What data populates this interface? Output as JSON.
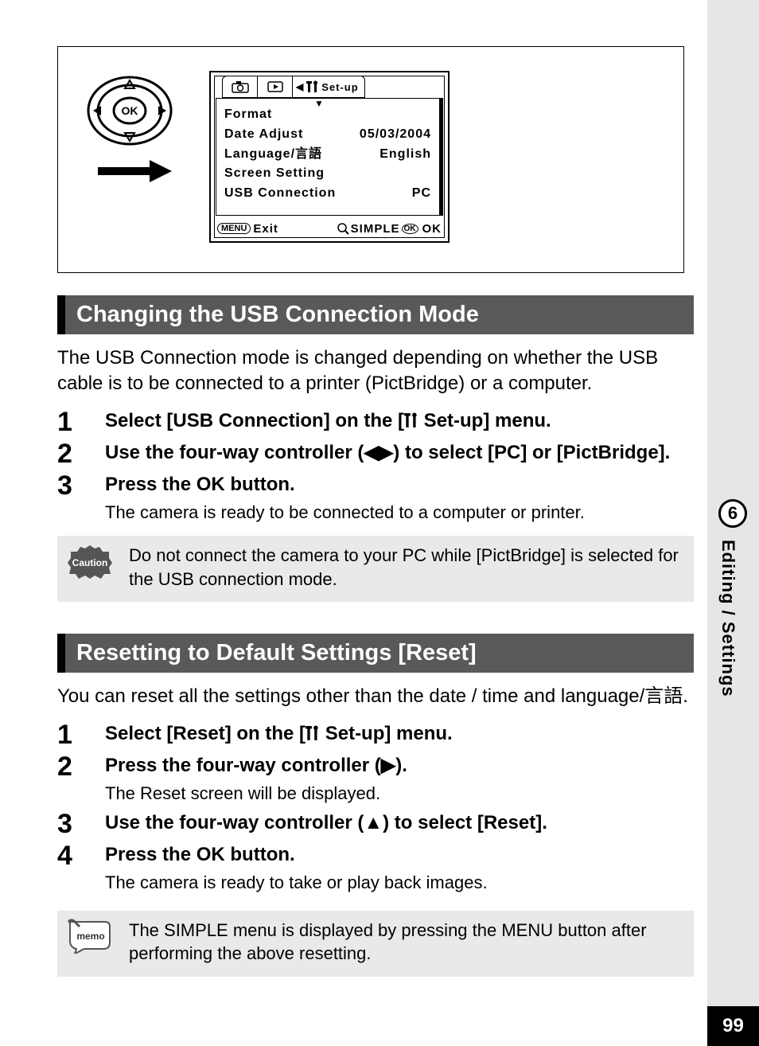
{
  "page_number": "99",
  "chapter_number": "6",
  "chapter_label": "Editing / Settings",
  "lcd": {
    "tab_label": "Set-up",
    "rows": [
      {
        "label": "Format",
        "value": ""
      },
      {
        "label": "Date Adjust",
        "value": "05/03/2004"
      },
      {
        "label": "Language/言語",
        "value": "English"
      },
      {
        "label": "Screen Setting",
        "value": ""
      },
      {
        "label": "USB Connection",
        "value": "PC"
      }
    ],
    "foot_menu": "MENU",
    "foot_exit": "Exit",
    "foot_simple": "SIMPLE",
    "foot_ok": "OK"
  },
  "section1": {
    "title": "Changing the USB Connection Mode",
    "intro": "The USB Connection mode is changed depending on whether the USB cable is to be connected to a printer (PictBridge) or a computer.",
    "steps": [
      {
        "n": "1",
        "title_pre": "Select [USB Connection] on the [",
        "title_post": " Set-up] menu."
      },
      {
        "n": "2",
        "title": "Use the four-way controller (◀▶) to select [PC] or [PictBridge]."
      },
      {
        "n": "3",
        "title": "Press the OK button.",
        "sub": "The camera is ready to be connected to a computer or printer."
      }
    ],
    "caution": "Do not connect the camera to your PC while [PictBridge] is selected for the USB connection mode."
  },
  "section2": {
    "title": "Resetting to Default Settings [Reset]",
    "intro": "You can reset all the settings other than the date / time and language/",
    "intro_suffix": "言語",
    "intro_end": ".",
    "steps": [
      {
        "n": "1",
        "title_pre": "Select [Reset] on the [",
        "title_post": " Set-up] menu."
      },
      {
        "n": "2",
        "title": "Press the four-way controller (▶).",
        "sub": "The Reset screen will be displayed."
      },
      {
        "n": "3",
        "title": "Use the four-way controller (▲) to select [Reset]."
      },
      {
        "n": "4",
        "title": "Press the OK button.",
        "sub": "The camera is ready to take or play back images."
      }
    ],
    "memo": "The SIMPLE menu is displayed by pressing the MENU button after performing the above resetting."
  }
}
